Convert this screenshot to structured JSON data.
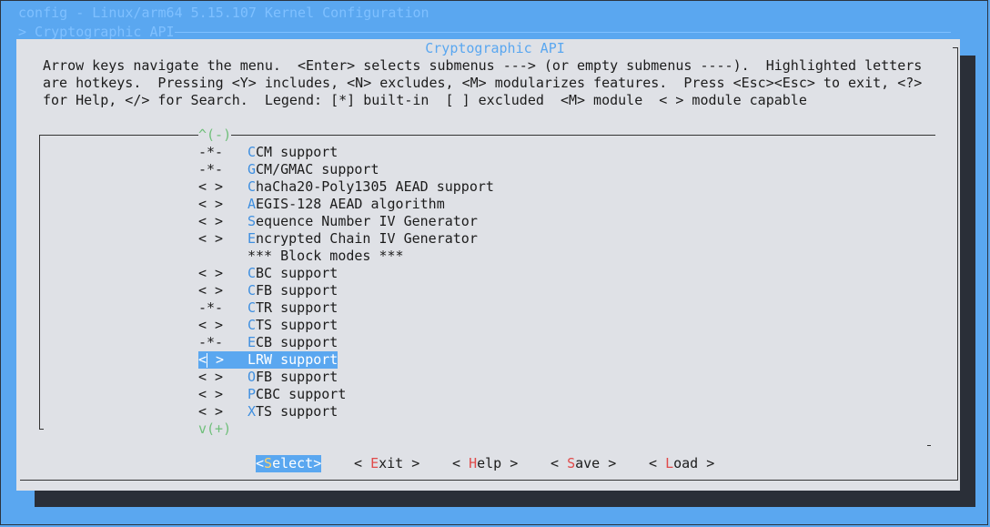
{
  "background": {
    "title": "config - Linux/arm64 5.15.107 Kernel Configuration",
    "section": "> Cryptographic API"
  },
  "dialog": {
    "title": "Cryptographic API",
    "help_lines": [
      "Arrow keys navigate the menu.  <Enter> selects submenus ---> (or empty submenus ----).  Highlighted letters",
      "are hotkeys.  Pressing <Y> includes, <N> excludes, <M> modularizes features.  Press <Esc><Esc> to exit, <?>",
      "for Help, </> for Search.  Legend: [*] built-in  [ ] excluded  <M> module  < > module capable"
    ],
    "scroll_up": "^(-)",
    "scroll_down": "v(+)",
    "items": [
      {
        "state": "-*-",
        "hotkey": "C",
        "rest": "CM support"
      },
      {
        "state": "-*-",
        "hotkey": "G",
        "rest": "CM/GMAC support"
      },
      {
        "state": "< >",
        "hotkey": "C",
        "rest": "haCha20-Poly1305 AEAD support"
      },
      {
        "state": "< >",
        "hotkey": "A",
        "rest": "EGIS-128 AEAD algorithm"
      },
      {
        "state": "< >",
        "hotkey": "S",
        "rest": "equence Number IV Generator"
      },
      {
        "state": "< >",
        "hotkey": "E",
        "rest": "ncrypted Chain IV Generator"
      },
      {
        "state": "",
        "hotkey": "",
        "rest": "*** Block modes ***"
      },
      {
        "state": "< >",
        "hotkey": "C",
        "rest": "BC support"
      },
      {
        "state": "< >",
        "hotkey": "C",
        "rest": "FB support"
      },
      {
        "state": "-*-",
        "hotkey": "C",
        "rest": "TR support"
      },
      {
        "state": "< >",
        "hotkey": "C",
        "rest": "TS support"
      },
      {
        "state": "-*-",
        "hotkey": "E",
        "rest": "CB support"
      },
      {
        "state": "< >",
        "hotkey": "L",
        "rest": "RW support",
        "selected": true
      },
      {
        "state": "< >",
        "hotkey": "O",
        "rest": "FB support"
      },
      {
        "state": "< >",
        "hotkey": "P",
        "rest": "CBC support"
      },
      {
        "state": "< >",
        "hotkey": "X",
        "rest": "TS support"
      }
    ],
    "buttons": [
      {
        "pre": "<",
        "hotkey": "S",
        "post": "elect>",
        "selected": true
      },
      {
        "pre": "< ",
        "hotkey": "E",
        "post": "xit >"
      },
      {
        "pre": "< ",
        "hotkey": "H",
        "post": "elp >"
      },
      {
        "pre": "< ",
        "hotkey": "S",
        "post": "ave >"
      },
      {
        "pre": "< ",
        "hotkey": "L",
        "post": "oad >"
      }
    ]
  },
  "colors": {
    "background": "#5aa7f0",
    "dialog": "#dfe1e6",
    "hotkey": "#3f8fe0",
    "selection": "#5aa7f0",
    "button_hotkey": "#e04a4a"
  }
}
